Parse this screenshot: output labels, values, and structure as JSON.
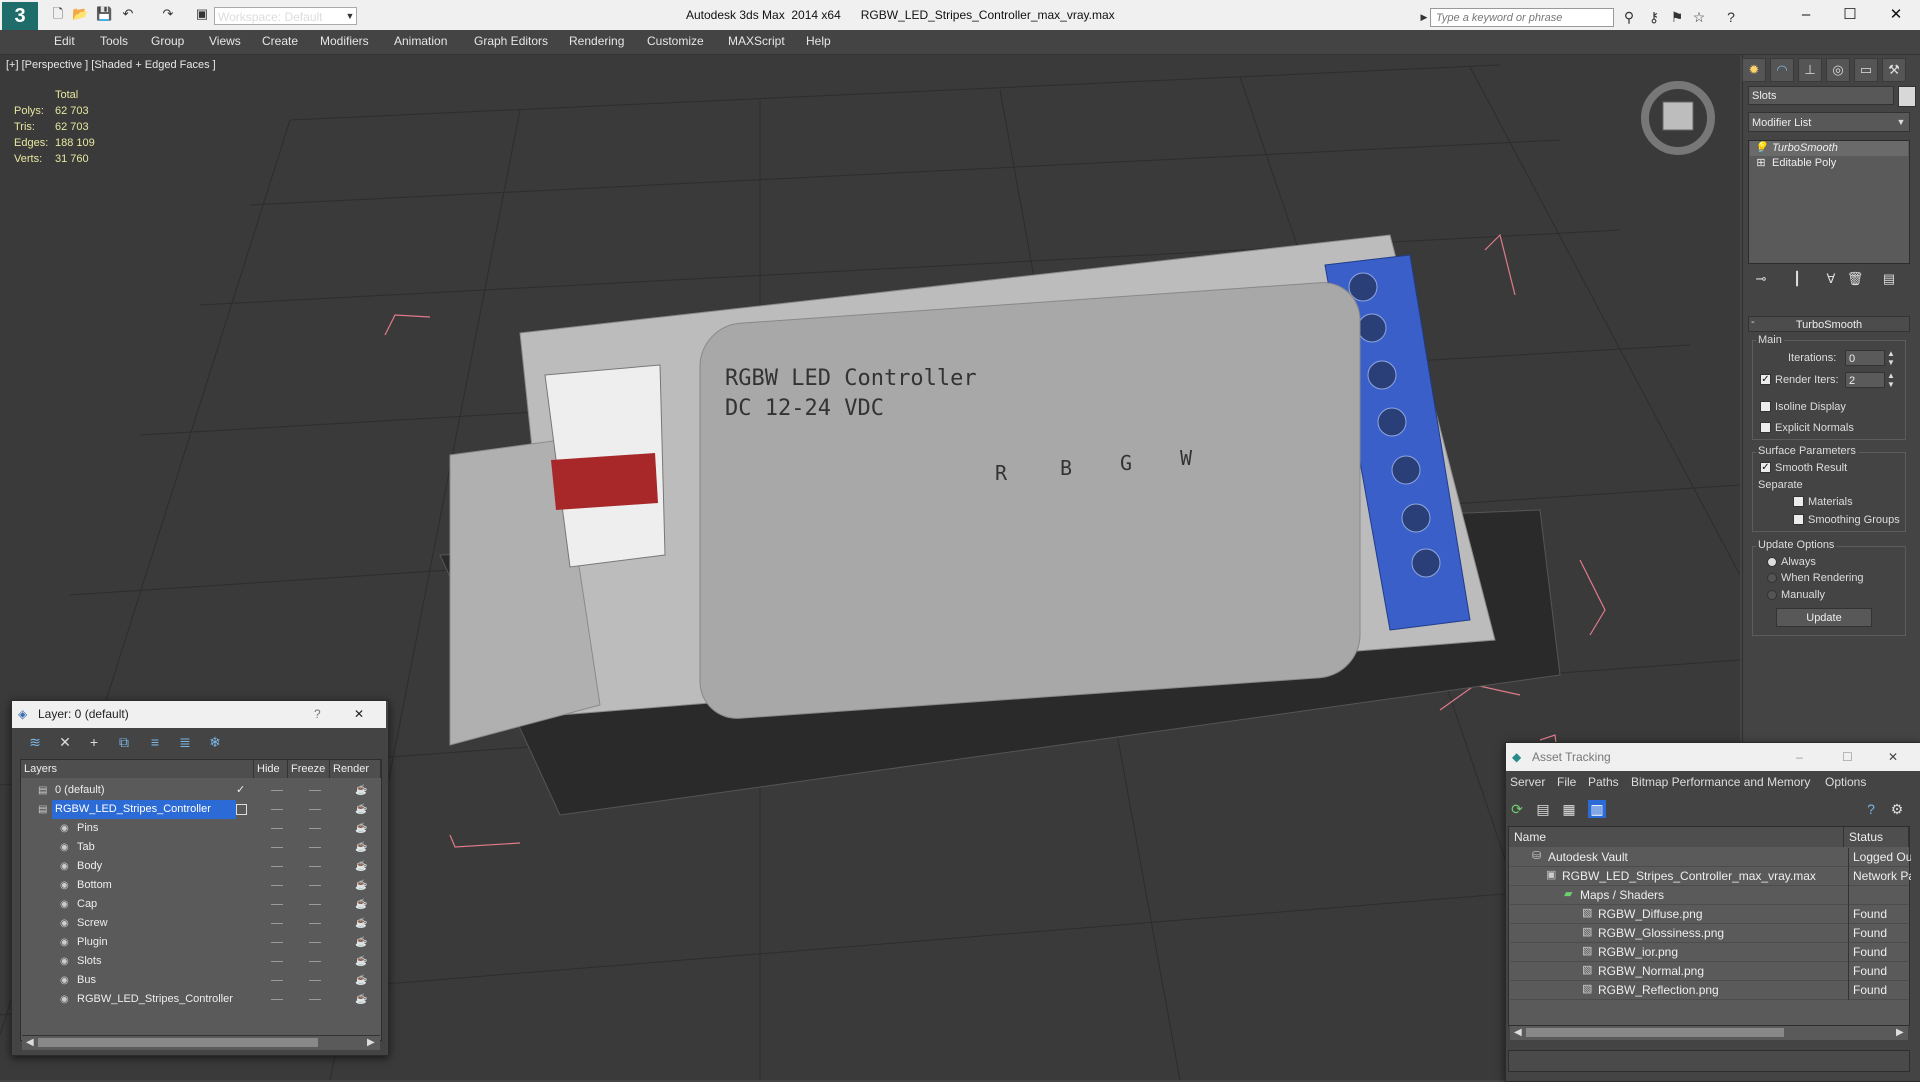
{
  "titlebar": {
    "logo": "3",
    "workspace": "Workspace: Default",
    "app_title": "Autodesk 3ds Max  2014 x64      RGBW_LED_Stripes_Controller_max_vray.max",
    "search_placeholder": "Type a keyword or phrase",
    "win_minimize": "–",
    "win_maximize": "☐",
    "win_close": "✕"
  },
  "menu": [
    "Edit",
    "Tools",
    "Group",
    "Views",
    "Create",
    "Modifiers",
    "Animation",
    "Graph Editors",
    "Rendering",
    "Customize",
    "MAXScript",
    "Help"
  ],
  "viewport": {
    "label": "[+] [Perspective ] [Shaded + Edged Faces ]",
    "stats_header": "Total",
    "stats": [
      {
        "label": "Polys:",
        "value": "62 703"
      },
      {
        "label": "Tris:",
        "value": "62 703"
      },
      {
        "label": "Edges:",
        "value": "188 109"
      },
      {
        "label": "Verts:",
        "value": "31 760"
      }
    ]
  },
  "command_panel": {
    "slots_label": "Slots",
    "modifier_list": "Modifier List",
    "stack": [
      "TurboSmooth",
      "Editable Poly"
    ],
    "rollout_title": "TurboSmooth",
    "main_group": "Main",
    "iterations_label": "Iterations:",
    "iterations_value": "0",
    "render_iters_label": "Render Iters:",
    "render_iters_value": "2",
    "isoline_label": "Isoline Display",
    "explicit_label": "Explicit Normals",
    "surface_group": "Surface Parameters",
    "smooth_result_label": "Smooth Result",
    "separate_label": "Separate",
    "materials_label": "Materials",
    "smoothing_label": "Smoothing Groups",
    "update_group": "Update Options",
    "always_label": "Always",
    "when_rendering_label": "When Rendering",
    "manually_label": "Manually",
    "update_button": "Update"
  },
  "layer_dialog": {
    "title": "Layer: 0 (default)",
    "help": "?",
    "close": "✕",
    "columns": {
      "layers": "Layers",
      "hide": "Hide",
      "freeze": "Freeze",
      "render": "Render"
    },
    "rows": [
      {
        "name": "0 (default)"
      },
      {
        "name": "RGBW_LED_Stripes_Controller"
      },
      {
        "name": "Pins"
      },
      {
        "name": "Tab"
      },
      {
        "name": "Body"
      },
      {
        "name": "Bottom"
      },
      {
        "name": "Cap"
      },
      {
        "name": "Screw"
      },
      {
        "name": "Plugin"
      },
      {
        "name": "Slots"
      },
      {
        "name": "Bus"
      },
      {
        "name": "RGBW_LED_Stripes_Controller"
      }
    ]
  },
  "asset_tracking": {
    "title": "Asset Tracking",
    "menu": [
      "Server",
      "File",
      "Paths",
      "Bitmap Performance and Memory",
      "Options"
    ],
    "columns": {
      "name": "Name",
      "status": "Status"
    },
    "rows": [
      {
        "name": "Autodesk Vault",
        "status": "Logged Out"
      },
      {
        "name": "RGBW_LED_Stripes_Controller_max_vray.max",
        "status": "Network Pa"
      },
      {
        "name": "Maps / Shaders",
        "status": ""
      },
      {
        "name": "RGBW_Diffuse.png",
        "status": "Found"
      },
      {
        "name": "RGBW_Glossiness.png",
        "status": "Found"
      },
      {
        "name": "RGBW_ior.png",
        "status": "Found"
      },
      {
        "name": "RGBW_Normal.png",
        "status": "Found"
      },
      {
        "name": "RGBW_Reflection.png",
        "status": "Found"
      }
    ]
  },
  "model_label": {
    "line1": "RGBW LED Controller",
    "line2": "DC 12-24 VDC",
    "grid_headers": [
      "R",
      "B",
      "G",
      "W"
    ]
  },
  "colors": {
    "accent_blue": "#3a5fc9",
    "selected_row": "#2c6bd6",
    "viewport_bg": "#3a3a3a",
    "stats_yellow": "#e8e8a0"
  }
}
